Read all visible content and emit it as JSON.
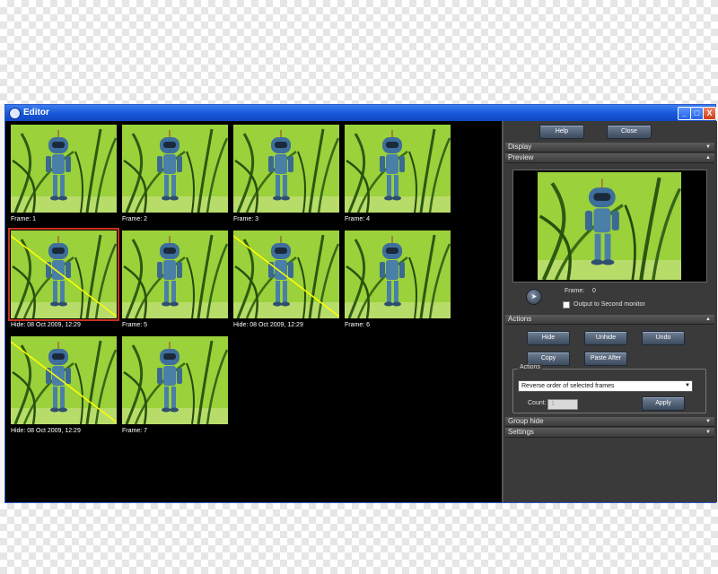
{
  "window": {
    "title": "Editor"
  },
  "titlebar_buttons": [
    "_",
    "□",
    "X"
  ],
  "frames": [
    {
      "label": "Frame: 1",
      "hidden": false,
      "selected": false
    },
    {
      "label": "Frame: 2",
      "hidden": false,
      "selected": false
    },
    {
      "label": "Frame: 3",
      "hidden": false,
      "selected": false
    },
    {
      "label": "Frame: 4",
      "hidden": false,
      "selected": false
    },
    {
      "label": "Hide: 08 Oct 2009, 12:29",
      "hidden": true,
      "selected": true
    },
    {
      "label": "Frame: 5",
      "hidden": false,
      "selected": false
    },
    {
      "label": "Hide: 08 Oct 2009, 12:29",
      "hidden": true,
      "selected": false
    },
    {
      "label": "Frame: 6",
      "hidden": false,
      "selected": false
    },
    {
      "label": "Hide: 08 Oct 2009, 12:29",
      "hidden": true,
      "selected": false
    },
    {
      "label": "Frame: 7",
      "hidden": false,
      "selected": false
    }
  ],
  "panel": {
    "help_label": "Help",
    "close_label": "Close",
    "sections": {
      "display": "Display",
      "preview": "Preview",
      "actions": "Actions",
      "group_hide": "Group hide",
      "settings": "Settings"
    },
    "preview": {
      "frame_label": "Frame:",
      "frame_value": "0",
      "second_monitor_label": "Output to Second monitor"
    },
    "actions": {
      "hide_label": "Hide",
      "unhide_label": "Unhide",
      "undo_label": "Undo",
      "copy_label": "Copy",
      "paste_after_label": "Paste After",
      "group_label": "Actions",
      "selected_action": "Reverse order of selected frames",
      "count_label": "Count:",
      "count_value": "1",
      "apply_label": "Apply"
    }
  },
  "colors": {
    "titlebar": "#1656d8",
    "background": "#000000",
    "panel": "#3a3a3a",
    "hide_line": "#ffff00",
    "selection": "#c8331e",
    "grass_bg": "#9bd13a"
  },
  "icons": [
    "app-icon",
    "minimize-icon",
    "maximize-icon",
    "close-icon",
    "play-icon",
    "chevron-down-icon",
    "chevron-up-icon"
  ]
}
